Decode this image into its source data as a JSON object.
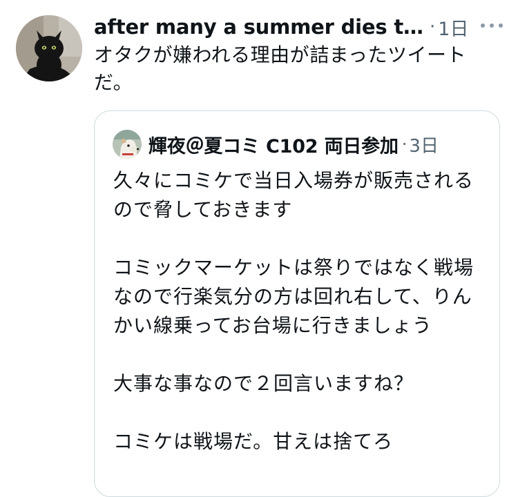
{
  "tweet": {
    "display_name": "after many a summer dies the...",
    "timestamp": "1日",
    "dot": "·",
    "text": "オタクが嫌われる理由が詰まったツイートだ。",
    "avatar_icon": "black-cat-avatar",
    "more_icon": "more-options-icon"
  },
  "quote": {
    "display_name": "輝夜＠夏コミ C102 両日参加",
    "timestamp": "3日",
    "dot": "·",
    "avatar_icon": "dog-avatar",
    "text": "久々にコミケで当日入場券が販売されるので脅しておきます\n\nコミックマーケットは祭りではなく戦場なので行楽気分の方は回れ右して、りんかい線乗ってお台場に行きましょう\n\n大事な事なので２回言いますね？\n\nコミケは戦場だ。甘えは捨てろ"
  },
  "colors": {
    "text_primary": "#0f1419",
    "text_secondary": "#536471",
    "border": "#cfd9de",
    "background": "#ffffff"
  }
}
